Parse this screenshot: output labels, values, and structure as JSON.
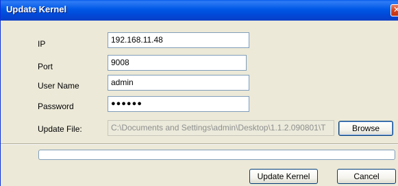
{
  "window": {
    "title": "Update Kernel",
    "close_glyph": "✕"
  },
  "form": {
    "ip_label": "IP",
    "ip_value": "192.168.11.48",
    "port_label": "Port",
    "port_value": "9008",
    "username_label": "User Name",
    "username_value": "admin",
    "password_label": "Password",
    "password_masked": "●●●●●●",
    "update_file_label": "Update File:",
    "update_file_value": "C:\\Documents and Settings\\admin\\Desktop\\1.1.2.090801\\T"
  },
  "buttons": {
    "browse": "Browse",
    "update_kernel": "Update Kernel",
    "cancel": "Cancel"
  },
  "progress": {
    "fraction": 0
  },
  "colors": {
    "titlebar": "#0058e6",
    "dialog_bg": "#ece9d8",
    "close_button": "#d6431c"
  }
}
